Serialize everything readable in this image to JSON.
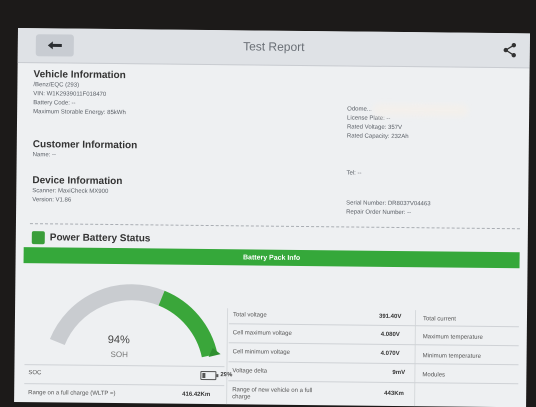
{
  "header": {
    "title": "Test Report"
  },
  "vehicle": {
    "heading": "Vehicle Information",
    "model": "/Benz/EQC (293)",
    "vin": "VIN: W1K2939011F018470",
    "battery_code": "Battery Code: --",
    "max_energy": "Maximum Storable Energy: 85kWh"
  },
  "right_info": {
    "odometer": "Odome...",
    "license": "License Plate: --",
    "rated_voltage": "Rated Voltage: 357V",
    "rated_capacity": "Rated Capacity: 232Ah",
    "tel": "Tel: --",
    "serial": "Serial Number: DR8037V04463",
    "repair_order": "Repair Order Number: --"
  },
  "customer": {
    "heading": "Customer Information",
    "name": "Name: --"
  },
  "device": {
    "heading": "Device Information",
    "scanner": "Scanner: MaxiCheck MX900",
    "version": "Version: V1.86"
  },
  "battery_status": {
    "heading": "Power Battery Status",
    "pack_info": "Battery Pack Info"
  },
  "gauge": {
    "soh_percent": 94,
    "soh_value": "94%",
    "soh_label": "SOH",
    "arc_color": "#3aa63a",
    "track_color": "#c9ccd0"
  },
  "rows": {
    "soc_label": "SOC",
    "soc_value": "29%",
    "range_full_label": "Range on a full charge (WLTP =)",
    "range_full_value": "416.42Km"
  },
  "metrics": {
    "total_voltage_label": "Total voltage",
    "total_voltage_value": "391.40V",
    "total_current_label": "Total current",
    "cell_max_label": "Cell maximum voltage",
    "cell_max_value": "4.080V",
    "max_temp_label": "Maximum temperature",
    "cell_min_label": "Cell minimum voltage",
    "cell_min_value": "4.070V",
    "min_temp_label": "Minimum temperature",
    "delta_label": "Voltage delta",
    "delta_value": "9mV",
    "modules_label": "Modules",
    "new_range_label": "Range of new vehicle on a full",
    "new_range_label2": "charge",
    "new_range_value": "443Km"
  }
}
